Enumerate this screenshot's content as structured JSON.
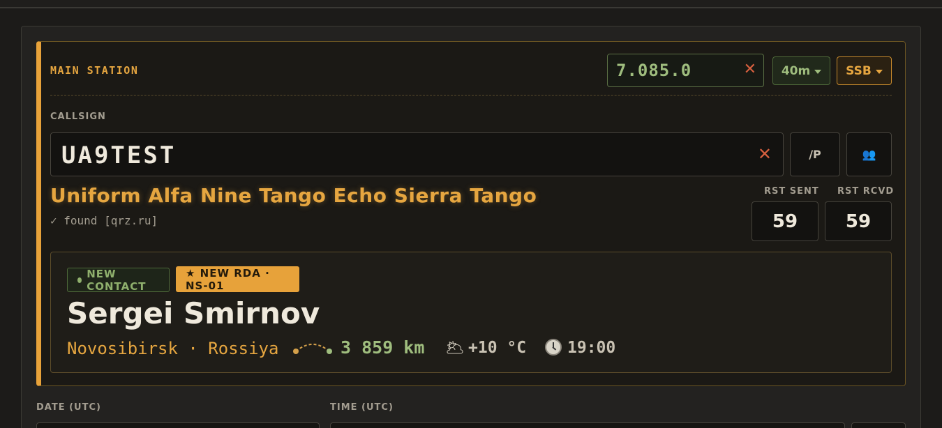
{
  "station": {
    "title": "MAIN STATION",
    "frequency": "7.085.0",
    "band": "40m",
    "mode": "SSB"
  },
  "callsign": {
    "label": "CALLSIGN",
    "value": "UA9TEST",
    "portable_label": "/P",
    "group_icon": "👥",
    "phonetic": "Uniform Alfa Nine Tango Echo Sierra Tango",
    "lookup_status": "✓ found [qrz.ru]"
  },
  "rst": {
    "sent_label": "RST SENT",
    "sent_value": "59",
    "rcvd_label": "RST RCVD",
    "rcvd_value": "59"
  },
  "contact": {
    "badge_new": "NEW CONTACT",
    "badge_rda": "★ NEW RDA · NS-01",
    "name": "Sergei Smirnov",
    "location": "Novosibirsk · Rossiya",
    "distance": "3 859 km",
    "weather_icon": "🌥",
    "temperature": "+10 °C",
    "local_time": "19:00"
  },
  "datetime": {
    "date_label": "DATE (UTC)",
    "time_label": "TIME (UTC)"
  },
  "colors": {
    "accent_amber": "#e7a23a",
    "accent_green": "#9fbd7e",
    "clear_red": "#d7603f"
  },
  "icons": {
    "clear": "close-icon",
    "dropdown": "chevron-down-icon",
    "distance": "distance-arc-icon",
    "weather": "weather-cloud-sun-icon",
    "clock": "clock-icon",
    "group": "group-icon"
  }
}
